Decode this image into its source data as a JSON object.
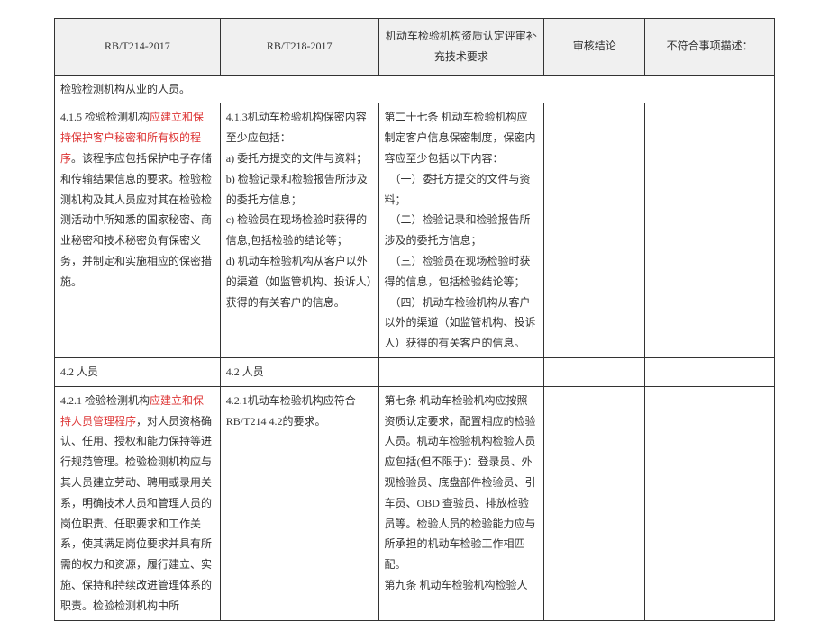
{
  "headers": {
    "h1": "RB/T214-2017",
    "h2": "RB/T218-2017",
    "h3": "机动车检验机构资质认定评审补充技术要求",
    "h4": "审核结论",
    "h5": "不符合事项描述："
  },
  "row1": {
    "c1": "检验检测机构从业的人员。"
  },
  "row2": {
    "c1a": "4.1.5 检验检测机构",
    "c1h": "应建立和保持保护客户秘密和所有权的程序",
    "c1b": "。该程序应包括保护电子存储和传输结果信息的要求。检验检测机构及其人员应对其在检验检测活动中所知悉的国家秘密、商业秘密和技术秘密负有保密义务，并制定和实施相应的保密措施。",
    "c2": "4.1.3机动车检验机构保密内容至少应包括：\na) 委托方提交的文件与资料；\nb) 检验记录和检验报告所涉及的委托方信息；\nc) 检验员在现场检验时获得的信息,包括检验的结论等；\nd) 机动车检验机构从客户以外的渠道（如监管机构、投诉人）获得的有关客户的信息。",
    "c3": "第二十七条 机动车检验机构应制定客户信息保密制度，保密内容应至少包括以下内容：\n　（一）委托方提交的文件与资料；\n　（二）检验记录和检验报告所涉及的委托方信息；\n　（三）检验员在现场检验时获得的信息，包括检验结论等；\n　（四）机动车检验机构从客户以外的渠道（如监管机构、投诉人）获得的有关客户的信息。"
  },
  "row3": {
    "c1": "4.2 人员",
    "c2": "4.2 人员"
  },
  "row4": {
    "c1a": "4.2.1 检验检测机构",
    "c1h": "应建立和保持人员管理程序",
    "c1b": "，对人员资格确认、任用、授权和能力保持等进行规范管理。检验检测机构应与其人员建立劳动、聘用或录用关系，明确技术人员和管理人员的岗位职责、任职要求和工作关系，使其满足岗位要求并具有所需的权力和资源，履行建立、实施、保持和持续改进管理体系的职责。检验检测机构中所",
    "c2": "4.2.1机动车检验机构应符合RB/T214 4.2的要求。",
    "c3": "第七条 机动车检验机构应按照资质认定要求，配置相应的检验人员。机动车检验机构检验人员应包括(但不限于)：登录员、外观检验员、底盘部件检验员、引车员、OBD 查验员、排放检验员等。检验人员的检验能力应与所承担的机动车检验工作相匹配。\n第九条 机动车检验机构检验人"
  }
}
